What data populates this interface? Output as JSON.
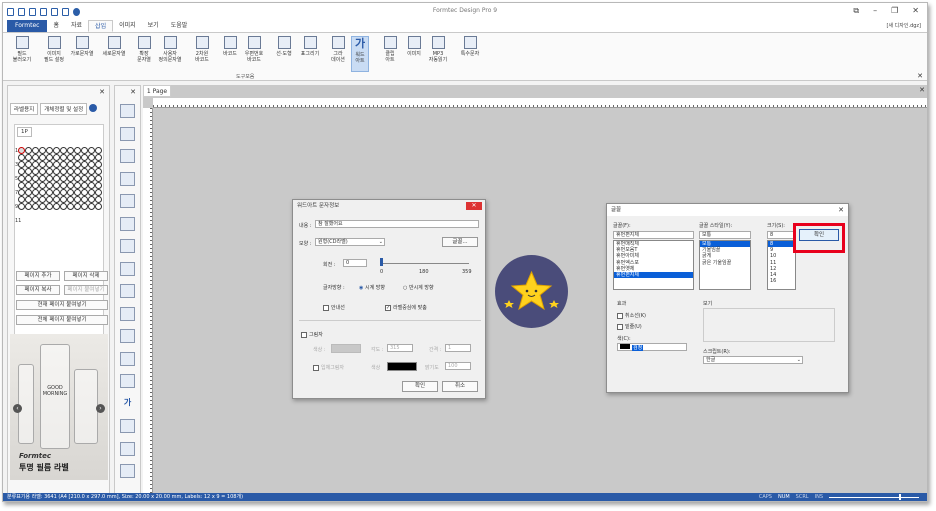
{
  "app": {
    "title": "Formtec Design Pro 9",
    "mdi_label": "[새 디자인.dgz]"
  },
  "tabs": [
    "Formtec",
    "홈",
    "자료",
    "삽입",
    "이미지",
    "보기",
    "도움말"
  ],
  "ribbon": {
    "buttons": [
      {
        "label": "필드\n불러오기",
        "icon": "field-load-icon"
      },
      {
        "label": "이미지\n필드 설정",
        "icon": "image-field-icon"
      },
      {
        "label": "가로문자열",
        "icon": "horizontal-text-icon"
      },
      {
        "label": "세로문자열",
        "icon": "vertical-text-icon"
      },
      {
        "label": "확장\n문자열",
        "icon": "extended-text-icon"
      },
      {
        "label": "사용자\n정의문자열",
        "icon": "custom-text-icon"
      },
      {
        "label": "2차원\n바코드",
        "icon": "qr-code-icon"
      },
      {
        "label": "바코드",
        "icon": "barcode-icon"
      },
      {
        "label": "우편번호\n바코드",
        "icon": "postal-barcode-icon"
      },
      {
        "label": "선·도형",
        "icon": "shape-icon"
      },
      {
        "label": "표그리기",
        "icon": "table-icon"
      },
      {
        "label": "그라\n데이션",
        "icon": "gradient-icon"
      },
      {
        "label": "워드\n아트",
        "icon": "wordart-icon"
      },
      {
        "label": "클립\n아트",
        "icon": "clipart-icon"
      },
      {
        "label": "이미지",
        "icon": "image-icon"
      },
      {
        "label": "MP3\n자동읽기",
        "icon": "mp3-icon"
      },
      {
        "label": "특수문자",
        "icon": "special-char-icon"
      }
    ],
    "group_label": "도구모음"
  },
  "left_panel": {
    "tabs": [
      "라벨용지",
      "개체정렬 및 설정"
    ],
    "page_tab": "1P",
    "row_labels": [
      "1",
      "3",
      "5",
      "7",
      "9",
      "11"
    ],
    "buttons": [
      "페이지 추가",
      "페이지 삭제",
      "페이지 복사",
      "페이지 붙여넣기",
      "현재 페이지 붙여넣기",
      "전체 페이지 붙여넣기"
    ],
    "ad": {
      "brand": "Formtec",
      "title": "투명 필름 라벨",
      "bottle_text": "GOOD MORNING"
    }
  },
  "document": {
    "tab": "1 Page"
  },
  "wordart_dialog": {
    "title": "워드아트 문자정보",
    "content_label": "내용 :",
    "content_value": "참 잘했어요",
    "shape_label": "모양 :",
    "shape_value": "원형(CD라벨)",
    "font_button": "글꼴...",
    "rotate_label": "회전 :",
    "rotate_value": "0",
    "slider_ticks": [
      "0",
      "180",
      "359"
    ],
    "direction_label": "글자방향 :",
    "direction_options": [
      "시계 방향",
      "반시계 방향"
    ],
    "check_inner": "안내선",
    "check_center": "라벨중심에 맞춤",
    "shadow_label": "그림자",
    "color_label": "색상 :",
    "angle_label": "각도 :",
    "angle_value": "315",
    "distance_label": "간격 :",
    "distance_value": "1",
    "solid_shadow_label": "입체그림자",
    "solid_color_label": "색상",
    "density_label": "밝기도",
    "density_value": "100",
    "ok": "확인",
    "cancel": "취소"
  },
  "font_dialog": {
    "title": "글꼴",
    "font_label": "글꼴(F):",
    "font_value": "휴먼편지체",
    "style_label": "글꼴 스타일(Y):",
    "style_value": "보통",
    "size_label": "크기(S):",
    "size_value": "8",
    "fonts": [
      "휴먼매직체",
      "휴먼모음T",
      "휴먼아미체",
      "휴먼엑스포",
      "휴먼옛체",
      "휴먼편지체"
    ],
    "styles": [
      "보통",
      "기울임꼴",
      "굵게",
      "굵은 기울임꼴"
    ],
    "sizes": [
      "8",
      "9",
      "10",
      "11",
      "12",
      "14",
      "16"
    ],
    "ok": "확인",
    "effects_label": "효과",
    "strike_label": "취소선(K)",
    "underline_label": "밑줄(U)",
    "color_label": "색(C):",
    "color_value": "검정",
    "preview_label": "보기",
    "script_label": "스크립트(R):",
    "script_value": "한글"
  },
  "status": {
    "text": "분류표기용 라벨: 3641 (A4 [210.0 x 297.0 mm], Size: 20.00 x 20.00 mm, Labels: 12 x 9 = 108개)",
    "indicators": [
      "CAPS",
      "NUM",
      "SCRL",
      "INS"
    ]
  },
  "colors": {
    "accent": "#2a5aa7",
    "highlight_border": "#e8001c",
    "star": "#ffd21e"
  }
}
